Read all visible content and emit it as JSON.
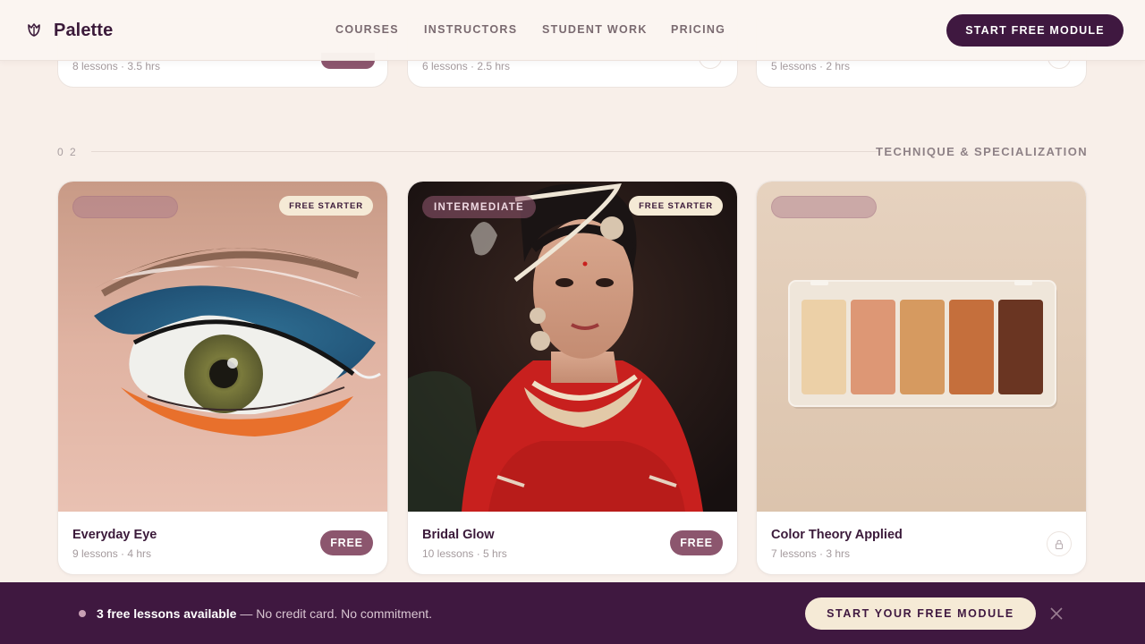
{
  "brand": {
    "name": "Palette",
    "logo_icon": "tulip-logo-icon"
  },
  "nav": [
    "COURSES",
    "INSTRUCTORS",
    "STUDENT WORK",
    "PRICING"
  ],
  "header_cta": "START FREE MODULE",
  "previous_row": [
    {
      "meta": "8 lessons · 3.5 hrs",
      "access": "free"
    },
    {
      "meta": "6 lessons · 2.5 hrs",
      "access": "locked"
    },
    {
      "meta": "5 lessons · 2 hrs",
      "access": "locked"
    }
  ],
  "section": {
    "number": "0 2",
    "title": "TECHNIQUE & SPECIALIZATION"
  },
  "cards": [
    {
      "title": "Everyday Eye",
      "meta": "9 lessons · 4 hrs",
      "level": "",
      "starter_badge": "FREE STARTER",
      "action": "FREE",
      "image": "blue-orange-eye-makeup-photo"
    },
    {
      "title": "Bridal Glow",
      "meta": "10 lessons · 5 hrs",
      "level": "INTERMEDIATE",
      "starter_badge": "FREE STARTER",
      "action": "FREE",
      "image": "bridal-portrait-photo"
    },
    {
      "title": "Color Theory Applied",
      "meta": "7 lessons · 3 hrs",
      "level": "",
      "starter_badge": "",
      "action": "locked",
      "image": "eyeshadow-palette-photo"
    }
  ],
  "bottom_bar": {
    "highlight": "3 free lessons available",
    "text": " — No credit card. No commitment.",
    "cta": "START YOUR FREE MODULE",
    "close_icon": "close-icon"
  },
  "colors": {
    "primary": "#3f1840",
    "accent": "#8c566e",
    "background": "#f8efe9",
    "cream": "#f5ead6"
  }
}
